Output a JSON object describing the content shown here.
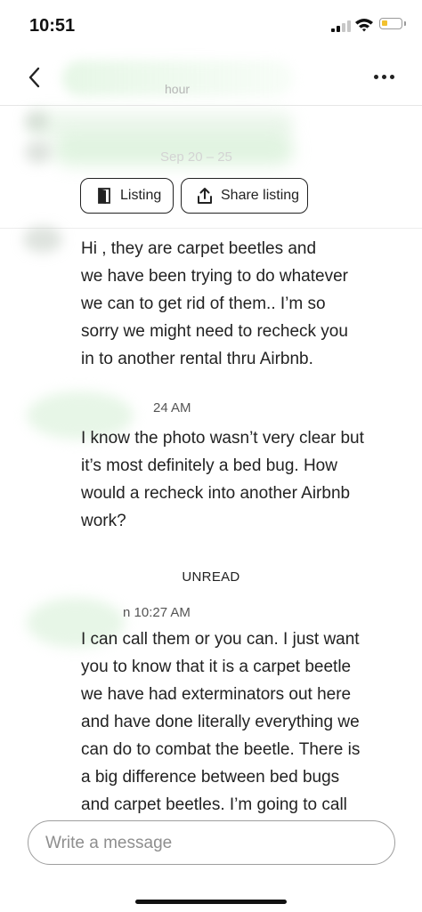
{
  "status_bar": {
    "time": "10:51"
  },
  "header": {
    "subtitle_fragment": "hour"
  },
  "banner": {
    "date_fragment": "Sep 20 – 25"
  },
  "actions": {
    "listing_label": "Listing",
    "share_label": "Share listing"
  },
  "messages": [
    {
      "time": "",
      "text": "Hi , they are carpet beetles and\nwe have been trying to do whatever\nwe can to get rid of them.. I’m so\nsorry we might need to recheck you\nin to another rental thru Airbnb."
    },
    {
      "time": "24 AM",
      "text": "I know the photo wasn’t very clear but\nit’s most definitely a bed bug. How\nwould a recheck into another Airbnb\nwork?"
    },
    {
      "time": "n 10:27 AM",
      "text": "I can call them or you can. I just want\nyou to know that it is a carpet beetle\nwe have had exterminators out here\nand have done literally everything we\ncan do to combat the beetle.  There is\na big difference between bed bugs\nand carpet beetles. I’m going to call"
    }
  ],
  "unread_label": "UNREAD",
  "composer": {
    "placeholder": "Write a message"
  }
}
